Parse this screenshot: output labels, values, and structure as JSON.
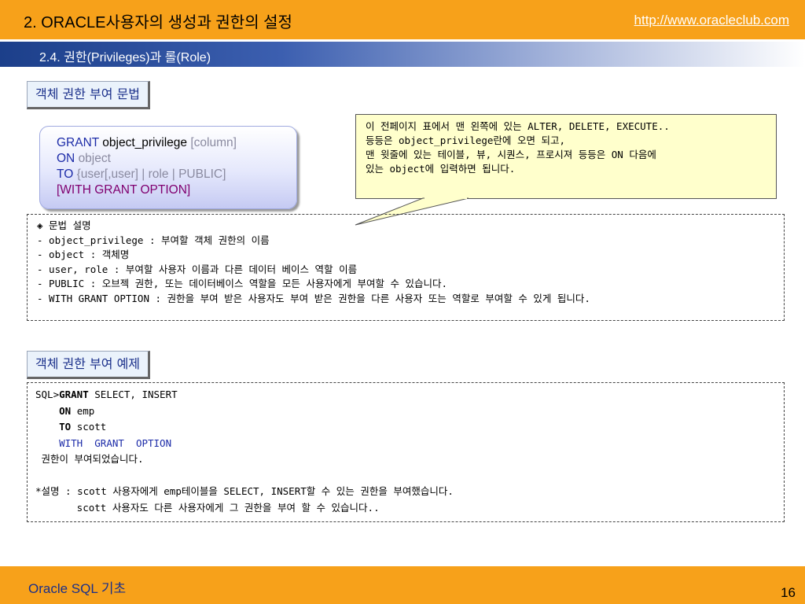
{
  "header": {
    "title": "2. ORACLE사용자의 생성과 권한의 설정",
    "url": "http://www.oracleclub.com"
  },
  "subheader": {
    "title": "2.4. 권한(Privileges)과 롤(Role)"
  },
  "section1": {
    "heading": "객체 권한 부여 문법",
    "syntax": {
      "grant_kw": "GRANT",
      "object_privilege": "object_privilege",
      "column": "[column]",
      "on_kw": "ON",
      "object": "object",
      "to_kw": "TO",
      "targets": "{user[,user] | role | PUBLIC]",
      "with_grant_option": "[WITH GRANT OPTION]"
    },
    "callout": [
      " 이 전페이지 표에서 맨 왼쪽에 있는 ALTER, DELETE, EXECUTE..",
      "등등은 object_privilege란에 오면 되고,",
      "맨 윗줄에 있는 테이블, 뷰, 시퀀스, 프로시져 등등은 ON 다음에",
      "있는 object에 입력하면 됩니다."
    ],
    "description": [
      "◈ 문법 설명",
      " - object_privilege : 부여할 객체 권한의 이름",
      " - object : 객체명",
      " - user, role : 부여할 사용자 이름과 다른 데이터 베이스 역할 이름",
      " - PUBLIC : 오브젝 권한, 또는 데이터베이스 역할을 모든 사용자에게 부여할 수 있습니다.",
      " - WITH GRANT OPTION : 권한을 부여 받은 사용자도 부여 받은 권한을 다른 사용자 또는 역할로 부여할 수 있게 됩니다."
    ]
  },
  "section2": {
    "heading": "객체 권한 부여 예제",
    "example": {
      "prompt": "SQL>",
      "grant_kw": "GRANT",
      "grant_rest": " SELECT, INSERT",
      "on_kw": "ON",
      "on_rest": " emp",
      "to_kw": "TO",
      "to_rest": " scott",
      "with_line": "WITH  GRANT  OPTION",
      "result": " 권한이 부여되었습니다.",
      "note1": "*설명 : scott 사용자에게 emp테이블을 SELECT, INSERT할 수 있는 권한을 부여했습니다.",
      "note2": "       scott 사용자도 다른 사용자에게 그 권한을 부여 할 수 있습니다.."
    }
  },
  "footer": {
    "label": "Oracle SQL 기초",
    "page": "16"
  },
  "colors": {
    "orange": "#f7a11a",
    "navy": "#1c3f8a",
    "keyword_blue": "#1c2ba8",
    "keyword_magenta": "#800070",
    "callout_bg": "#ffffcc"
  }
}
